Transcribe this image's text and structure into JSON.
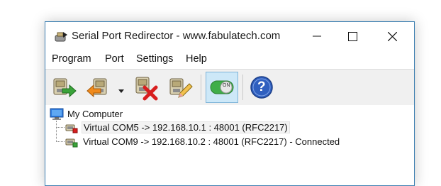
{
  "window": {
    "title": "Serial Port Redirector - www.fabulatech.com"
  },
  "menubar": {
    "items": [
      "Program",
      "Port",
      "Settings",
      "Help"
    ]
  },
  "toolbar": {
    "buttons": [
      {
        "name": "add-port",
        "icon": "port-add-icon"
      },
      {
        "name": "add-port-dropdown",
        "icon": "port-add-orange-icon"
      },
      {
        "name": "remove-port",
        "icon": "port-remove-icon"
      },
      {
        "name": "edit-port",
        "icon": "port-edit-icon"
      },
      {
        "name": "toggle-on",
        "icon": "toggle-on-icon",
        "label": "ON"
      },
      {
        "name": "help",
        "icon": "help-icon",
        "label": "?"
      }
    ]
  },
  "tree": {
    "root": "My Computer",
    "ports": [
      "Virtual COM5 -> 192.168.10.1 : 48001 (RFC2217)",
      "Virtual COM9 -> 192.168.10.2 : 48001 (RFC2217) - Connected"
    ]
  },
  "colors": {
    "accent": "#3c7fb1",
    "toggle_active": "#cde8f8",
    "toggle_green": "#3fae49",
    "help_blue": "#2f5fbf"
  }
}
